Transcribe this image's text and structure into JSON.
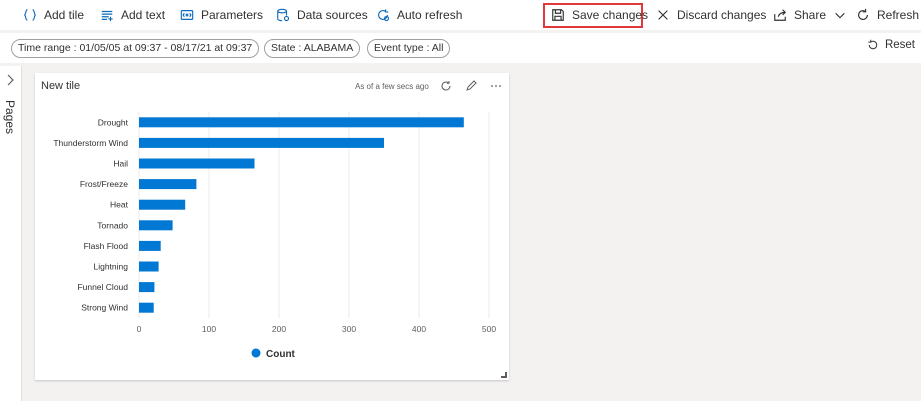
{
  "toolbar": {
    "add_tile": "Add tile",
    "add_text": "Add text",
    "parameters": "Parameters",
    "data_sources": "Data sources",
    "auto_refresh": "Auto refresh",
    "save_changes": "Save changes",
    "discard_changes": "Discard changes",
    "share": "Share",
    "refresh": "Refresh"
  },
  "filters": {
    "time_range": "Time range : 01/05/05 at 09:37 - 08/17/21 at 09:37",
    "state": "State : ALABAMA",
    "event_type": "Event type : All",
    "reset": "Reset"
  },
  "side": {
    "pages_label": "Pages"
  },
  "tile": {
    "title": "New tile",
    "as_of": "As of a few secs ago"
  },
  "colors": {
    "accent": "#0f6cbd",
    "bar": "#0078d4",
    "highlight": "#e0383b"
  },
  "chart_data": {
    "type": "bar",
    "orientation": "horizontal",
    "categories": [
      "Drought",
      "Thunderstorm Wind",
      "Hail",
      "Frost/Freeze",
      "Heat",
      "Tornado",
      "Flash Flood",
      "Lightning",
      "Funnel Cloud",
      "Strong Wind"
    ],
    "series": [
      {
        "name": "Count",
        "values": [
          464,
          350,
          165,
          82,
          66,
          48,
          31,
          28,
          22,
          21
        ]
      }
    ],
    "xticks": [
      0,
      100,
      200,
      300,
      400,
      500
    ],
    "xlim": [
      0,
      500
    ],
    "grid": true,
    "legend": "bottom-center"
  }
}
